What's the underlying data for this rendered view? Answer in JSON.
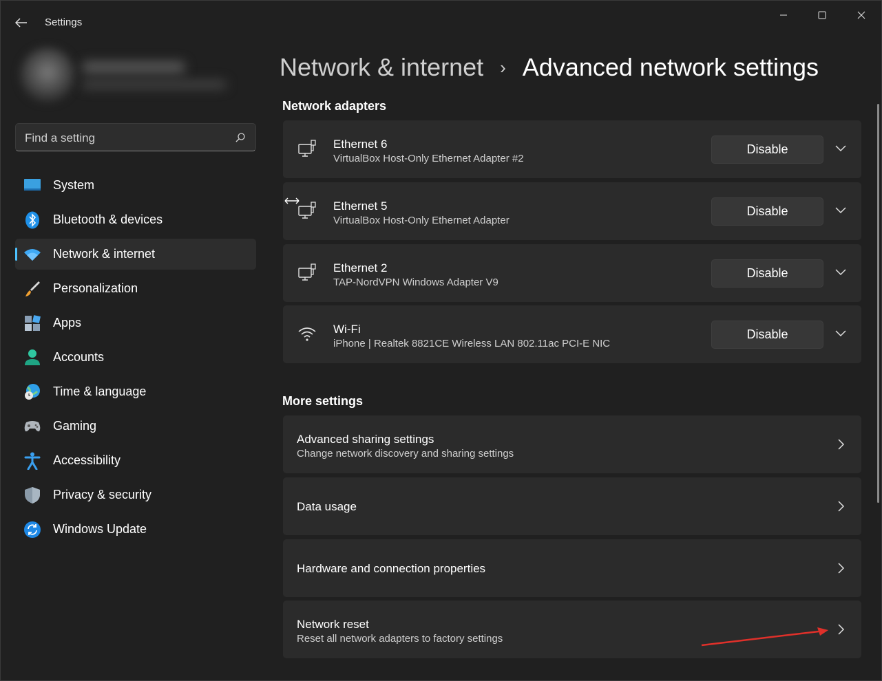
{
  "window": {
    "app_title": "Settings"
  },
  "search": {
    "placeholder": "Find a setting"
  },
  "sidebar": {
    "items": [
      {
        "label": "System",
        "icon": "system-icon"
      },
      {
        "label": "Bluetooth & devices",
        "icon": "bluetooth-icon"
      },
      {
        "label": "Network & internet",
        "icon": "wifi-icon",
        "active": true
      },
      {
        "label": "Personalization",
        "icon": "brush-icon"
      },
      {
        "label": "Apps",
        "icon": "apps-icon"
      },
      {
        "label": "Accounts",
        "icon": "accounts-icon"
      },
      {
        "label": "Time & language",
        "icon": "globe-clock-icon"
      },
      {
        "label": "Gaming",
        "icon": "gamepad-icon"
      },
      {
        "label": "Accessibility",
        "icon": "accessibility-icon"
      },
      {
        "label": "Privacy & security",
        "icon": "shield-icon"
      },
      {
        "label": "Windows Update",
        "icon": "update-icon"
      }
    ]
  },
  "breadcrumb": {
    "parent": "Network & internet",
    "separator": "›",
    "current": "Advanced network settings"
  },
  "adapters": {
    "section_title": "Network adapters",
    "items": [
      {
        "name": "Ethernet 6",
        "description": "VirtualBox Host-Only Ethernet Adapter #2",
        "button": "Disable",
        "icon": "ethernet-icon"
      },
      {
        "name": "Ethernet 5",
        "description": "VirtualBox Host-Only Ethernet Adapter",
        "button": "Disable",
        "icon": "ethernet-icon"
      },
      {
        "name": "Ethernet 2",
        "description": "TAP-NordVPN Windows Adapter V9",
        "button": "Disable",
        "icon": "ethernet-icon"
      },
      {
        "name": "Wi-Fi",
        "description": "iPhone | Realtek 8821CE Wireless LAN 802.11ac PCI-E NIC",
        "button": "Disable",
        "icon": "wifi-icon"
      }
    ]
  },
  "more_settings": {
    "section_title": "More settings",
    "items": [
      {
        "title": "Advanced sharing settings",
        "subtitle": "Change network discovery and sharing settings"
      },
      {
        "title": "Data usage",
        "subtitle": ""
      },
      {
        "title": "Hardware and connection properties",
        "subtitle": ""
      },
      {
        "title": "Network reset",
        "subtitle": "Reset all network adapters to factory settings"
      }
    ]
  },
  "colors": {
    "accent": "#4cc2ff",
    "background": "#202020",
    "card": "#2b2b2b",
    "annotation_arrow": "#e0302a"
  }
}
